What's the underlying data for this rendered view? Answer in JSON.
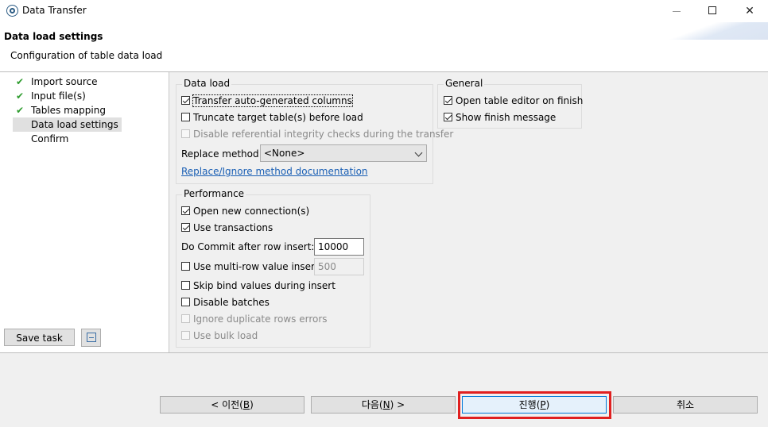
{
  "window": {
    "title": "Data Transfer",
    "app_icon": "dbeaver-icon"
  },
  "header": {
    "title": "Data load settings",
    "subtitle": "Configuration of table data load"
  },
  "nav": {
    "items": [
      {
        "label": "Import source",
        "done": true
      },
      {
        "label": "Input file(s)",
        "done": true
      },
      {
        "label": "Tables mapping",
        "done": true
      },
      {
        "label": "Data load settings",
        "done": false,
        "selected": true
      },
      {
        "label": "Confirm",
        "done": false
      }
    ],
    "save_task_label": "Save task",
    "task_icon": "task-config-icon"
  },
  "data_load": {
    "title": "Data load",
    "transfer_auto": {
      "label": "Transfer auto-generated columns",
      "checked": true
    },
    "truncate": {
      "label": "Truncate target table(s) before load",
      "checked": false
    },
    "disable_ri": {
      "label": "Disable referential integrity checks during the transfer",
      "checked": false
    },
    "replace_method_label": "Replace method:",
    "replace_method_value": "<None>",
    "doc_link": "Replace/Ignore method documentation"
  },
  "general": {
    "title": "General",
    "open_editor": {
      "label": "Open table editor on finish",
      "checked": true
    },
    "show_finish": {
      "label": "Show finish message",
      "checked": true
    }
  },
  "performance": {
    "title": "Performance",
    "open_conn": {
      "label": "Open new connection(s)",
      "checked": true
    },
    "use_tx": {
      "label": "Use transactions",
      "checked": true
    },
    "commit_label": "Do Commit after row insert:",
    "commit_value": "10000",
    "multirow": {
      "label": "Use multi-row value insert",
      "checked": false
    },
    "multirow_value": "500",
    "skip_bind": {
      "label": "Skip bind values during insert",
      "checked": false
    },
    "disable_batches": {
      "label": "Disable batches",
      "checked": false
    },
    "ignore_dup": {
      "label": "Ignore duplicate rows errors",
      "checked": false
    },
    "bulk_load": {
      "label": "Use bulk load",
      "checked": false
    }
  },
  "buttons": {
    "back_prefix": "< 이전(",
    "back_key": "B",
    "back_suffix": ")",
    "next_prefix": "다음(",
    "next_key": "N",
    "next_suffix": ") >",
    "finish_prefix": "진행(",
    "finish_key": "P",
    "finish_suffix": ")",
    "cancel": "취소"
  },
  "colors": {
    "highlight": "#e02020",
    "check_green": "#2e9c2e",
    "link": "#1a5fb4"
  }
}
